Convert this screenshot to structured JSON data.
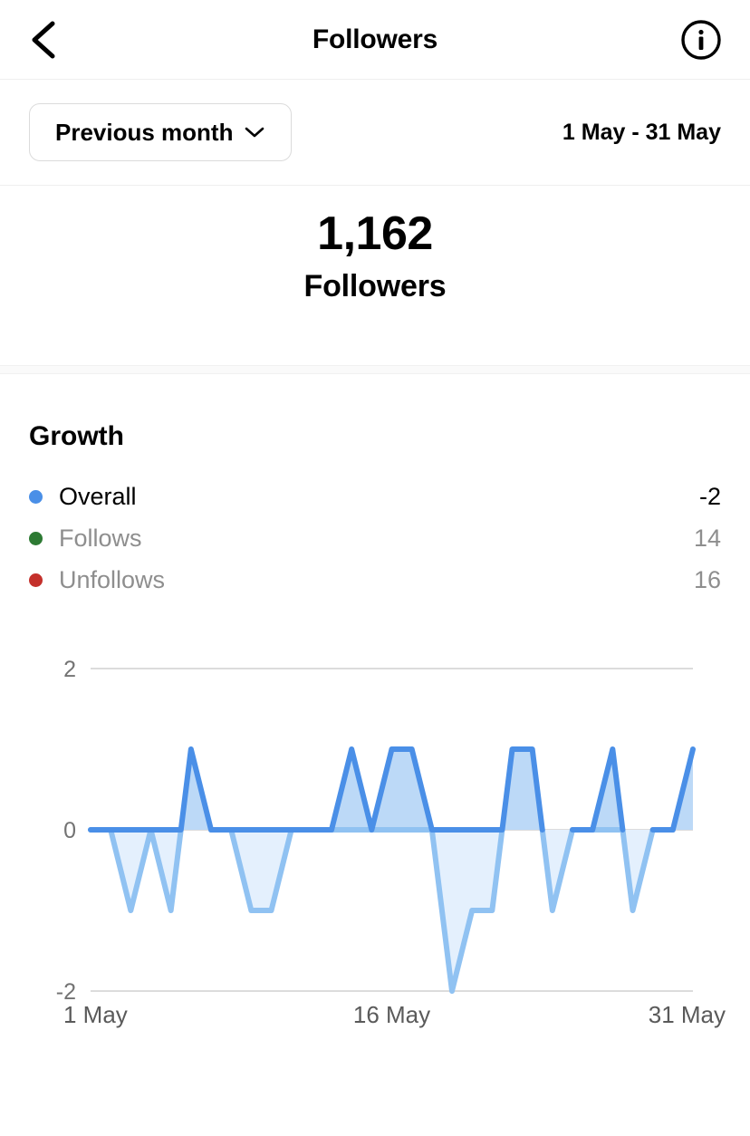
{
  "header": {
    "back_icon": "chevron-left-icon",
    "title": "Followers",
    "info_icon": "info-circle-icon"
  },
  "filter": {
    "period_label": "Previous month",
    "chevron_icon": "chevron-down-icon",
    "date_range": "1 May - 31 May"
  },
  "summary": {
    "value": "1,162",
    "label": "Followers"
  },
  "growth": {
    "title": "Growth",
    "legend": [
      {
        "name": "Overall",
        "value": "-2",
        "color": "#4a8fe7",
        "active": true
      },
      {
        "name": "Follows",
        "value": "14",
        "color": "#2d7a33",
        "active": false
      },
      {
        "name": "Unfollows",
        "value": "16",
        "color": "#c4302b",
        "active": false
      }
    ]
  },
  "colors": {
    "line_positive": "#4a8fe7",
    "line_negative": "#90c2f2",
    "fill_positive": "#bcd9f7",
    "fill_negative": "#e4f0fd",
    "gridline": "#dcdcdc",
    "text_muted": "#737373"
  },
  "chart_data": {
    "type": "area",
    "title": "Growth",
    "xlabel": "",
    "ylabel": "",
    "ylim": [
      -2,
      2
    ],
    "yticks": [
      2,
      0,
      -2
    ],
    "ytick_labels": [
      "2",
      "0",
      "-2"
    ],
    "xticks": [
      1,
      16,
      31
    ],
    "xtick_labels": [
      "1 May",
      "16 May",
      "31 May"
    ],
    "grid": true,
    "legend_position": "above",
    "series": [
      {
        "name": "Overall",
        "color": "#4a8fe7",
        "x": [
          1,
          2,
          3,
          4,
          5,
          6,
          7,
          8,
          9,
          10,
          11,
          12,
          13,
          14,
          15,
          16,
          17,
          18,
          19,
          20,
          21,
          22,
          23,
          24,
          25,
          26,
          27,
          28,
          29,
          30,
          31
        ],
        "values": [
          0,
          0,
          -1,
          0,
          -1,
          1,
          0,
          0,
          -1,
          -1,
          0,
          0,
          0,
          1,
          0,
          1,
          1,
          0,
          -2,
          -1,
          -1,
          1,
          1,
          -1,
          0,
          0,
          1,
          -1,
          0,
          0,
          1
        ]
      }
    ]
  }
}
